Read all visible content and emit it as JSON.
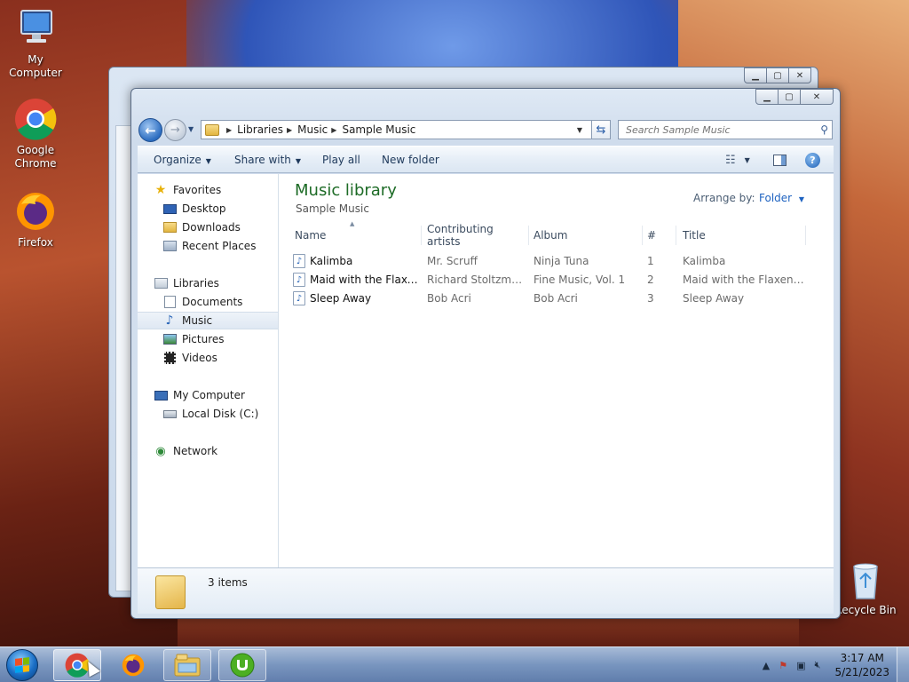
{
  "desktop": {
    "icons": [
      {
        "label": "My Computer"
      },
      {
        "label": "Google Chrome"
      },
      {
        "label": "Firefox"
      },
      {
        "label": "Recycle Bin"
      }
    ]
  },
  "window": {
    "address": {
      "crumbs": [
        "Libraries",
        "Music",
        "Sample Music"
      ]
    },
    "search": {
      "placeholder": "Search Sample Music"
    },
    "toolbar": {
      "organize": "Organize",
      "share_with": "Share with",
      "play_all": "Play all",
      "new_folder": "New folder"
    },
    "nav": {
      "favorites": "Favorites",
      "desktop": "Desktop",
      "downloads": "Downloads",
      "recent_places": "Recent Places",
      "libraries": "Libraries",
      "documents": "Documents",
      "music": "Music",
      "pictures": "Pictures",
      "videos": "Videos",
      "my_computer": "My Computer",
      "local_disk": "Local Disk (C:)",
      "network": "Network"
    },
    "content": {
      "title": "Music library",
      "subtitle": "Sample Music",
      "arrange_label": "Arrange by:",
      "arrange_value": "Folder",
      "columns": [
        "Name",
        "Contributing artists",
        "Album",
        "#",
        "Title"
      ],
      "rows": [
        {
          "name": "Kalimba",
          "artist": "Mr. Scruff",
          "album": "Ninja Tuna",
          "num": "1",
          "title": "Kalimba"
        },
        {
          "name": "Maid with the Flaxe...",
          "artist": "Richard Stoltzman...",
          "album": "Fine Music, Vol. 1",
          "num": "2",
          "title": "Maid with the Flaxen H..."
        },
        {
          "name": "Sleep Away",
          "artist": "Bob Acri",
          "album": "Bob Acri",
          "num": "3",
          "title": "Sleep Away"
        }
      ]
    },
    "details": {
      "count": "3 items"
    }
  },
  "taskbar": {
    "clock_time": "3:17 AM",
    "clock_date": "5/21/2023"
  }
}
